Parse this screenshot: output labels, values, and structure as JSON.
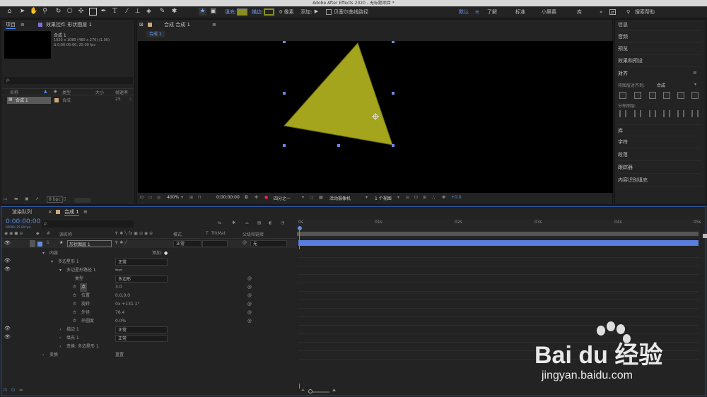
{
  "window": {
    "title": "Adobe After Effects 2020 - 无标题项目 *"
  },
  "toolbar": {
    "fill_label": "填充:",
    "stroke_label": "描边:",
    "stroke_width": "0 像素",
    "add_label": "添加:",
    "bezier_label": "贝塞尔曲线路径",
    "workspaces": [
      "默认",
      "了解",
      "标准",
      "小屏幕",
      "库"
    ],
    "search_placeholder": "搜索帮助",
    "fill_color": "#8b8f1f",
    "stroke_color": "#8b8f1f"
  },
  "project": {
    "tab": "项目",
    "effects_tab": "效果控件 形状图层 1",
    "comp_name": "合成 1",
    "info1": "1920 x 1080 (480 x 270) (1.00)",
    "info2": "Δ 0:00:05:00, 25.00 fps",
    "search_placeholder": "ρ.",
    "columns": [
      "名称",
      "类型",
      "大小",
      "帧速率"
    ],
    "items": [
      {
        "name": "合成 1",
        "type": "合成",
        "fps": "25"
      }
    ],
    "bpc": "8 bpc"
  },
  "composition": {
    "tab": "合成 合成 1",
    "breadcrumb": "合成 1",
    "zoom": "400%",
    "timecode": "0:00:00:00",
    "resolution": "四分之一",
    "camera": "活动摄像机",
    "views": "1 个视图",
    "exposure": "+0.0",
    "shape_color": "#a4a51d"
  },
  "right_panel": {
    "items": [
      "信息",
      "音频",
      "预览",
      "效果和预设"
    ],
    "align": {
      "title": "对齐",
      "align_to_label": "将图层对齐到:",
      "align_to_value": "合成",
      "distribute_label": "分布图层:"
    },
    "items2": [
      "库",
      "字符",
      "段落",
      "跟踪器",
      "内容识别填充"
    ]
  },
  "timeline": {
    "tabs": [
      "渲染队列",
      "合成 1"
    ],
    "timecode": "0:00:00:00",
    "frame_info": "00000 (25.00 fps)",
    "search_placeholder": "ρ.",
    "columns": {
      "num": "#",
      "source": "源名称",
      "mode": "模式",
      "t": "T",
      "trkmat": "TrkMat",
      "parent": "父级和链接"
    },
    "ruler": [
      "0s",
      "01s",
      "02s",
      "03s",
      "04s",
      "05s"
    ],
    "layer": {
      "num": "1",
      "name": "形状图层 1",
      "mode": "正常",
      "parent": "无"
    },
    "rows": [
      {
        "label": "内容",
        "extra": "添加:"
      },
      {
        "label": "多边星形 1",
        "value": "正常"
      },
      {
        "label": "多边星形路径 1"
      },
      {
        "label": "类型",
        "value": "多边形"
      },
      {
        "label": "点",
        "value": "3.0"
      },
      {
        "label": "位置",
        "value": "0.0,0.0"
      },
      {
        "label": "旋转",
        "value": "0x +131.1°"
      },
      {
        "label": "外径",
        "value": "76.4"
      },
      {
        "label": "外圆度",
        "value": "0.0%"
      },
      {
        "label": "描边 1",
        "value": "正常"
      },
      {
        "label": "填充 1",
        "value": "正常"
      },
      {
        "label": "变换: 多边星形 1"
      },
      {
        "label": "变换",
        "value": "重置"
      }
    ]
  },
  "watermark": {
    "logo": "Bai du 经验",
    "url": "jingyan.baidu.com"
  }
}
